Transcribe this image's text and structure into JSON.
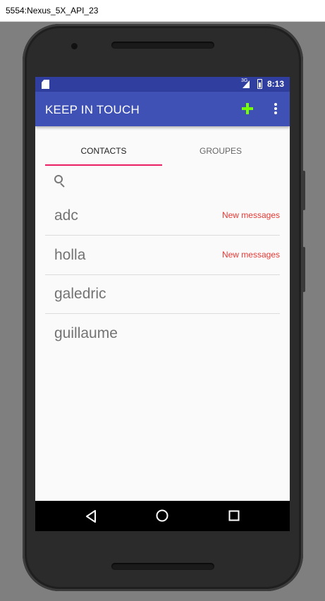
{
  "window": {
    "title": "5554:Nexus_5X_API_23"
  },
  "status_bar": {
    "network": "3G",
    "time": "8:13"
  },
  "app_bar": {
    "title": "KEEP IN TOUCH",
    "add_icon": "plus-icon",
    "add_color": "#76ff03",
    "overflow_icon": "more-vert-icon",
    "color": "#3f51b5"
  },
  "tabs": [
    {
      "label": "CONTACTS",
      "selected": true
    },
    {
      "label": "GROUPES",
      "selected": false
    }
  ],
  "search": {
    "icon": "search-icon"
  },
  "contacts": [
    {
      "name": "adc",
      "badge": "New messages"
    },
    {
      "name": "holla",
      "badge": "New messages"
    },
    {
      "name": "galedric",
      "badge": ""
    },
    {
      "name": "guillaume",
      "badge": ""
    }
  ],
  "colors": {
    "accent": "#e91e63",
    "badge": "#e53935",
    "status_bar": "#303f9f"
  },
  "nav_bar": {
    "back_icon": "back-icon",
    "home_icon": "home-icon",
    "recents_icon": "recents-icon"
  }
}
